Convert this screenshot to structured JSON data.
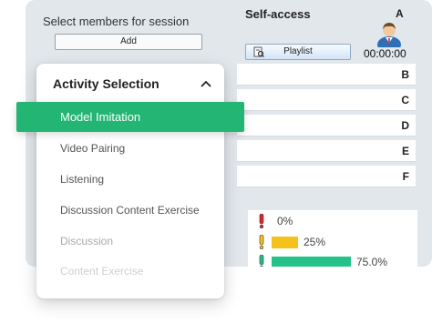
{
  "members": {
    "label": "Select members for session",
    "add_label": "Add"
  },
  "self_access": {
    "title": "Self-access",
    "playlist_label": "Playlist",
    "timer": "00:00:00",
    "groups": [
      "A",
      "B",
      "C",
      "D",
      "E",
      "F"
    ]
  },
  "activity_menu": {
    "title": "Activity Selection",
    "items": [
      {
        "label": "Model Imitation",
        "selected": true
      },
      {
        "label": "Video Pairing"
      },
      {
        "label": "Listening"
      },
      {
        "label": "Discussion Content Exercise"
      },
      {
        "label": "Discussion"
      },
      {
        "label": "Content Exercise"
      }
    ]
  },
  "progress": [
    {
      "label": "0%",
      "value": 0,
      "color": "#e0242b"
    },
    {
      "label": "25%",
      "value": 0.25,
      "color": "#f4c21a"
    },
    {
      "label": "75.0%",
      "value": 0.75,
      "color": "#22c28a"
    }
  ],
  "colors": {
    "accent": "#22b573",
    "panel_bg": "#e2e7ec"
  },
  "icons": [
    "avatar-icon",
    "playlist-icon",
    "chevron-up-icon",
    "exclamation-icon"
  ]
}
